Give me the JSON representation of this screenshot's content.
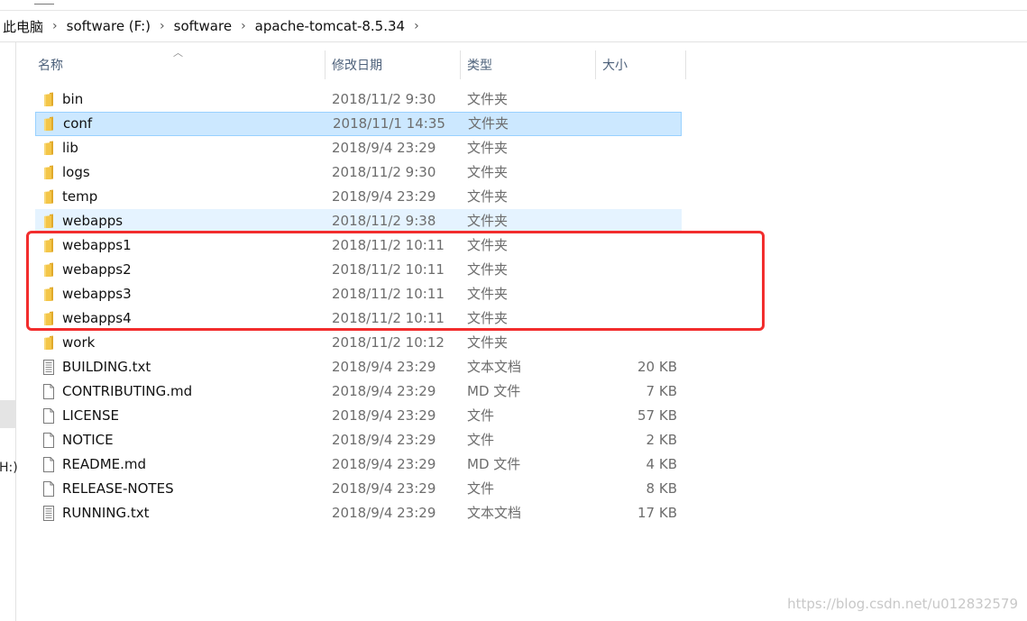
{
  "breadcrumb": [
    "此电脑",
    "software (F:)",
    "software",
    "apache-tomcat-8.5.34"
  ],
  "columns": {
    "name": "名称",
    "date": "修改日期",
    "type": "类型",
    "size": "大小"
  },
  "files": [
    {
      "name": "bin",
      "date": "2018/11/2 9:30",
      "type": "文件夹",
      "size": "",
      "icon": "folder-icon"
    },
    {
      "name": "conf",
      "date": "2018/11/1 14:35",
      "type": "文件夹",
      "size": "",
      "icon": "folder-icon",
      "state": "selected"
    },
    {
      "name": "lib",
      "date": "2018/9/4 23:29",
      "type": "文件夹",
      "size": "",
      "icon": "folder-icon"
    },
    {
      "name": "logs",
      "date": "2018/11/2 9:30",
      "type": "文件夹",
      "size": "",
      "icon": "folder-icon"
    },
    {
      "name": "temp",
      "date": "2018/9/4 23:29",
      "type": "文件夹",
      "size": "",
      "icon": "folder-icon"
    },
    {
      "name": "webapps",
      "date": "2018/11/2 9:38",
      "type": "文件夹",
      "size": "",
      "icon": "folder-icon",
      "state": "hovered"
    },
    {
      "name": "webapps1",
      "date": "2018/11/2 10:11",
      "type": "文件夹",
      "size": "",
      "icon": "folder-icon"
    },
    {
      "name": "webapps2",
      "date": "2018/11/2 10:11",
      "type": "文件夹",
      "size": "",
      "icon": "folder-icon"
    },
    {
      "name": "webapps3",
      "date": "2018/11/2 10:11",
      "type": "文件夹",
      "size": "",
      "icon": "folder-icon"
    },
    {
      "name": "webapps4",
      "date": "2018/11/2 10:11",
      "type": "文件夹",
      "size": "",
      "icon": "folder-icon"
    },
    {
      "name": "work",
      "date": "2018/11/2 10:12",
      "type": "文件夹",
      "size": "",
      "icon": "folder-icon"
    },
    {
      "name": "BUILDING.txt",
      "date": "2018/9/4 23:29",
      "type": "文本文档",
      "size": "20 KB",
      "icon": "text-file-icon"
    },
    {
      "name": "CONTRIBUTING.md",
      "date": "2018/9/4 23:29",
      "type": "MD 文件",
      "size": "7 KB",
      "icon": "file-icon"
    },
    {
      "name": "LICENSE",
      "date": "2018/9/4 23:29",
      "type": "文件",
      "size": "57 KB",
      "icon": "file-icon"
    },
    {
      "name": "NOTICE",
      "date": "2018/9/4 23:29",
      "type": "文件",
      "size": "2 KB",
      "icon": "file-icon"
    },
    {
      "name": "README.md",
      "date": "2018/9/4 23:29",
      "type": "MD 文件",
      "size": "4 KB",
      "icon": "file-icon"
    },
    {
      "name": "RELEASE-NOTES",
      "date": "2018/9/4 23:29",
      "type": "文件",
      "size": "8 KB",
      "icon": "file-icon"
    },
    {
      "name": "RUNNING.txt",
      "date": "2018/9/4 23:29",
      "type": "文本文档",
      "size": "17 KB",
      "icon": "text-file-icon"
    }
  ],
  "sidebar": {
    "partial_label": "H:)"
  },
  "colors": {
    "folder": "#f4c648",
    "selection": "#cce8ff",
    "hover": "#e5f3ff",
    "annotation": "#f22d2d"
  },
  "watermark": "https://blog.csdn.net/u012832579"
}
